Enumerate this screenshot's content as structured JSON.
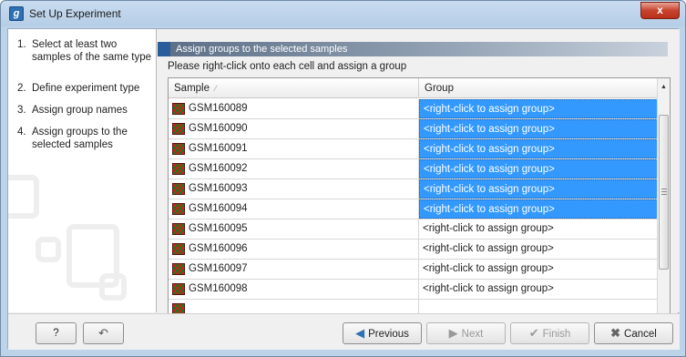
{
  "window": {
    "title": "Set Up Experiment",
    "app_icon_letter": "g",
    "close_symbol": "x"
  },
  "wizard_steps": [
    {
      "num": "1.",
      "label": "Select at least two samples of the same type"
    },
    {
      "num": "2.",
      "label": "Define experiment type"
    },
    {
      "num": "3.",
      "label": "Assign group names"
    },
    {
      "num": "4.",
      "label": "Assign groups to the selected samples"
    }
  ],
  "section": {
    "header": "Assign groups to the selected samples",
    "instruction": "Please right-click onto each cell and assign a group"
  },
  "table": {
    "columns": [
      "Sample",
      "Group"
    ],
    "sort_indicator": "⁄",
    "rows": [
      {
        "sample": "GSM160089",
        "group": "<right-click to assign group>",
        "selected": true
      },
      {
        "sample": "GSM160090",
        "group": "<right-click to assign group>",
        "selected": true
      },
      {
        "sample": "GSM160091",
        "group": "<right-click to assign group>",
        "selected": true
      },
      {
        "sample": "GSM160092",
        "group": "<right-click to assign group>",
        "selected": true
      },
      {
        "sample": "GSM160093",
        "group": "<right-click to assign group>",
        "selected": true
      },
      {
        "sample": "GSM160094",
        "group": "<right-click to assign group>",
        "selected": true
      },
      {
        "sample": "GSM160095",
        "group": "<right-click to assign group>",
        "selected": false
      },
      {
        "sample": "GSM160096",
        "group": "<right-click to assign group>",
        "selected": false
      },
      {
        "sample": "GSM160097",
        "group": "<right-click to assign group>",
        "selected": false
      },
      {
        "sample": "GSM160098",
        "group": "<right-click to assign group>",
        "selected": false
      }
    ]
  },
  "footer": {
    "help_label": "?",
    "reset_icon": "reset-icon",
    "previous_label": "Previous",
    "next_label": "Next",
    "finish_label": "Finish",
    "cancel_label": "Cancel"
  },
  "colors": {
    "selection": "#3399ff",
    "titlebar": "#bcd3ea",
    "close": "#c7432d"
  }
}
